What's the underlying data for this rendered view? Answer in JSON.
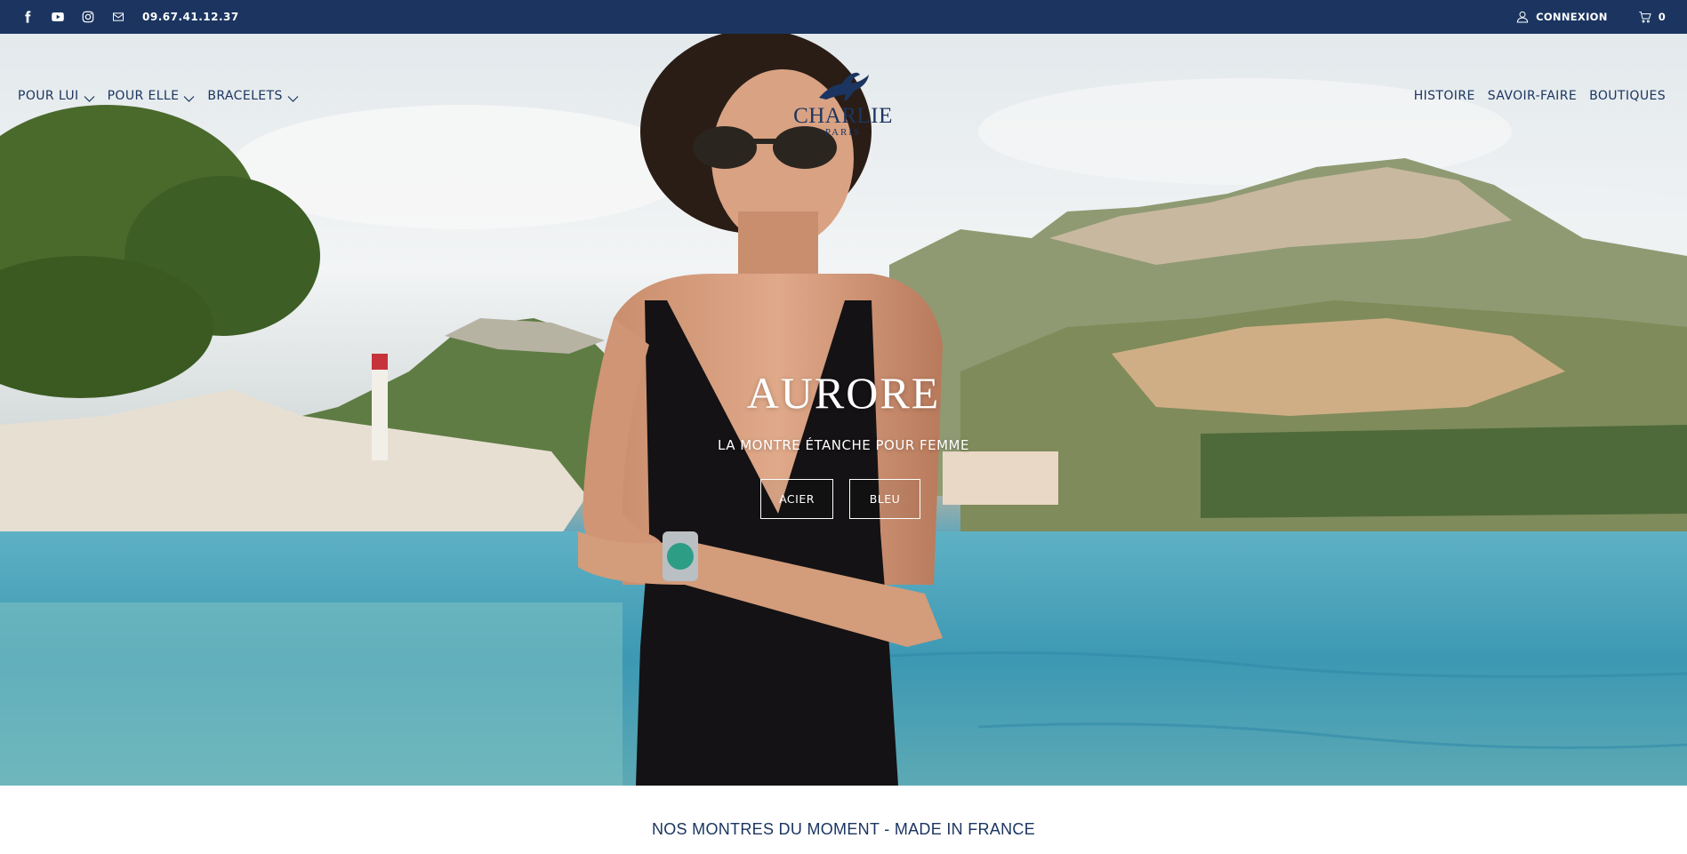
{
  "topbar": {
    "phone": "09.67.41.12.37",
    "icons": [
      "facebook-icon",
      "youtube-icon",
      "instagram-icon",
      "mail-icon"
    ],
    "login_label": "CONNEXION",
    "cart_count": "0"
  },
  "nav": {
    "left": [
      {
        "label": "POUR LUI",
        "has_dropdown": true
      },
      {
        "label": "POUR ELLE",
        "has_dropdown": true
      },
      {
        "label": "BRACELETS",
        "has_dropdown": true
      }
    ],
    "right": [
      {
        "label": "HISTOIRE"
      },
      {
        "label": "SAVOIR-FAIRE"
      },
      {
        "label": "BOUTIQUES"
      }
    ]
  },
  "logo": {
    "name": "CHARLIE",
    "sub": "PARIS"
  },
  "hero": {
    "title": "AURORE",
    "subtitle": "LA MONTRE ÉTANCHE POUR FEMME",
    "buttons": [
      "ACIER",
      "BLEU"
    ]
  },
  "section": {
    "title": "NOS MONTRES DU MOMENT - MADE IN FRANCE"
  },
  "colors": {
    "brand_navy": "#1b3560",
    "white": "#ffffff"
  }
}
